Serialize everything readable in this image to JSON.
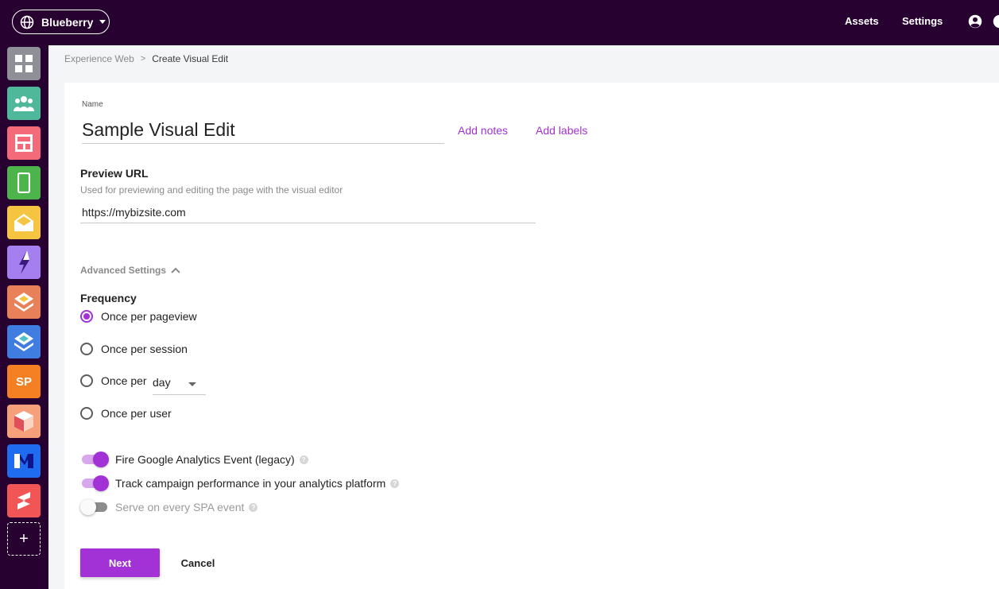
{
  "topbar": {
    "workspace": "Blueberry",
    "links": [
      "Assets",
      "Settings"
    ],
    "icons": [
      "globe-icon",
      "account-circle-icon",
      "help-icon"
    ]
  },
  "sidebar": {
    "apps": [
      {
        "name": "dashboard",
        "color": "#8f8f98",
        "icon": "grid-icon"
      },
      {
        "name": "audiences",
        "color": "#4fb89a",
        "icon": "people-icon"
      },
      {
        "name": "web-layout",
        "color": "#f56a78",
        "icon": "layout-icon"
      },
      {
        "name": "mobile",
        "color": "#4cb44a",
        "icon": "phone-icon"
      },
      {
        "name": "email",
        "color": "#f5c542",
        "icon": "envelope-icon"
      },
      {
        "name": "lightning",
        "color": "#a57ff0",
        "icon": "bolt-icon"
      },
      {
        "name": "layers-orange",
        "color": "#e8815a",
        "icon": "layers-icon"
      },
      {
        "name": "layers-blue",
        "color": "#3f7ee0",
        "icon": "layers-icon"
      },
      {
        "name": "sp",
        "color": "#f58024",
        "icon": "text-tile",
        "text": "SP"
      },
      {
        "name": "cube",
        "color": "#f5a07a",
        "icon": "cube-icon"
      },
      {
        "name": "brand-m",
        "color": "#1f6cf0",
        "icon": "m-logo-icon"
      },
      {
        "name": "brand-s",
        "color": "#f25555",
        "icon": "s-logo-icon"
      }
    ],
    "add_label": "+"
  },
  "breadcrumb": {
    "parent": "Experience Web",
    "separator": ">",
    "current": "Create Visual Edit"
  },
  "form": {
    "name_label": "Name",
    "name_value": "Sample Visual Edit",
    "add_notes": "Add notes",
    "add_labels": "Add labels",
    "preview_title": "Preview URL",
    "preview_help": "Used for previewing and editing the page with the visual editor",
    "preview_value": "https://mybizsite.com",
    "advanced_label": "Advanced Settings",
    "frequency_title": "Frequency",
    "frequency_options": [
      {
        "label": "Once per pageview",
        "checked": true
      },
      {
        "label": "Once per session",
        "checked": false
      },
      {
        "label": "Once per",
        "checked": false
      },
      {
        "label": "Once per user",
        "checked": false
      }
    ],
    "period_select": "day",
    "toggles": [
      {
        "label": "Fire Google Analytics Event (legacy)",
        "on": true
      },
      {
        "label": "Track campaign performance in your analytics platform",
        "on": true
      },
      {
        "label": "Serve on every SPA event",
        "on": false
      }
    ],
    "help_glyph": "?",
    "next_label": "Next",
    "cancel_label": "Cancel"
  },
  "colors": {
    "topbar_bg": "#27012f",
    "accent": "#a232d6"
  }
}
